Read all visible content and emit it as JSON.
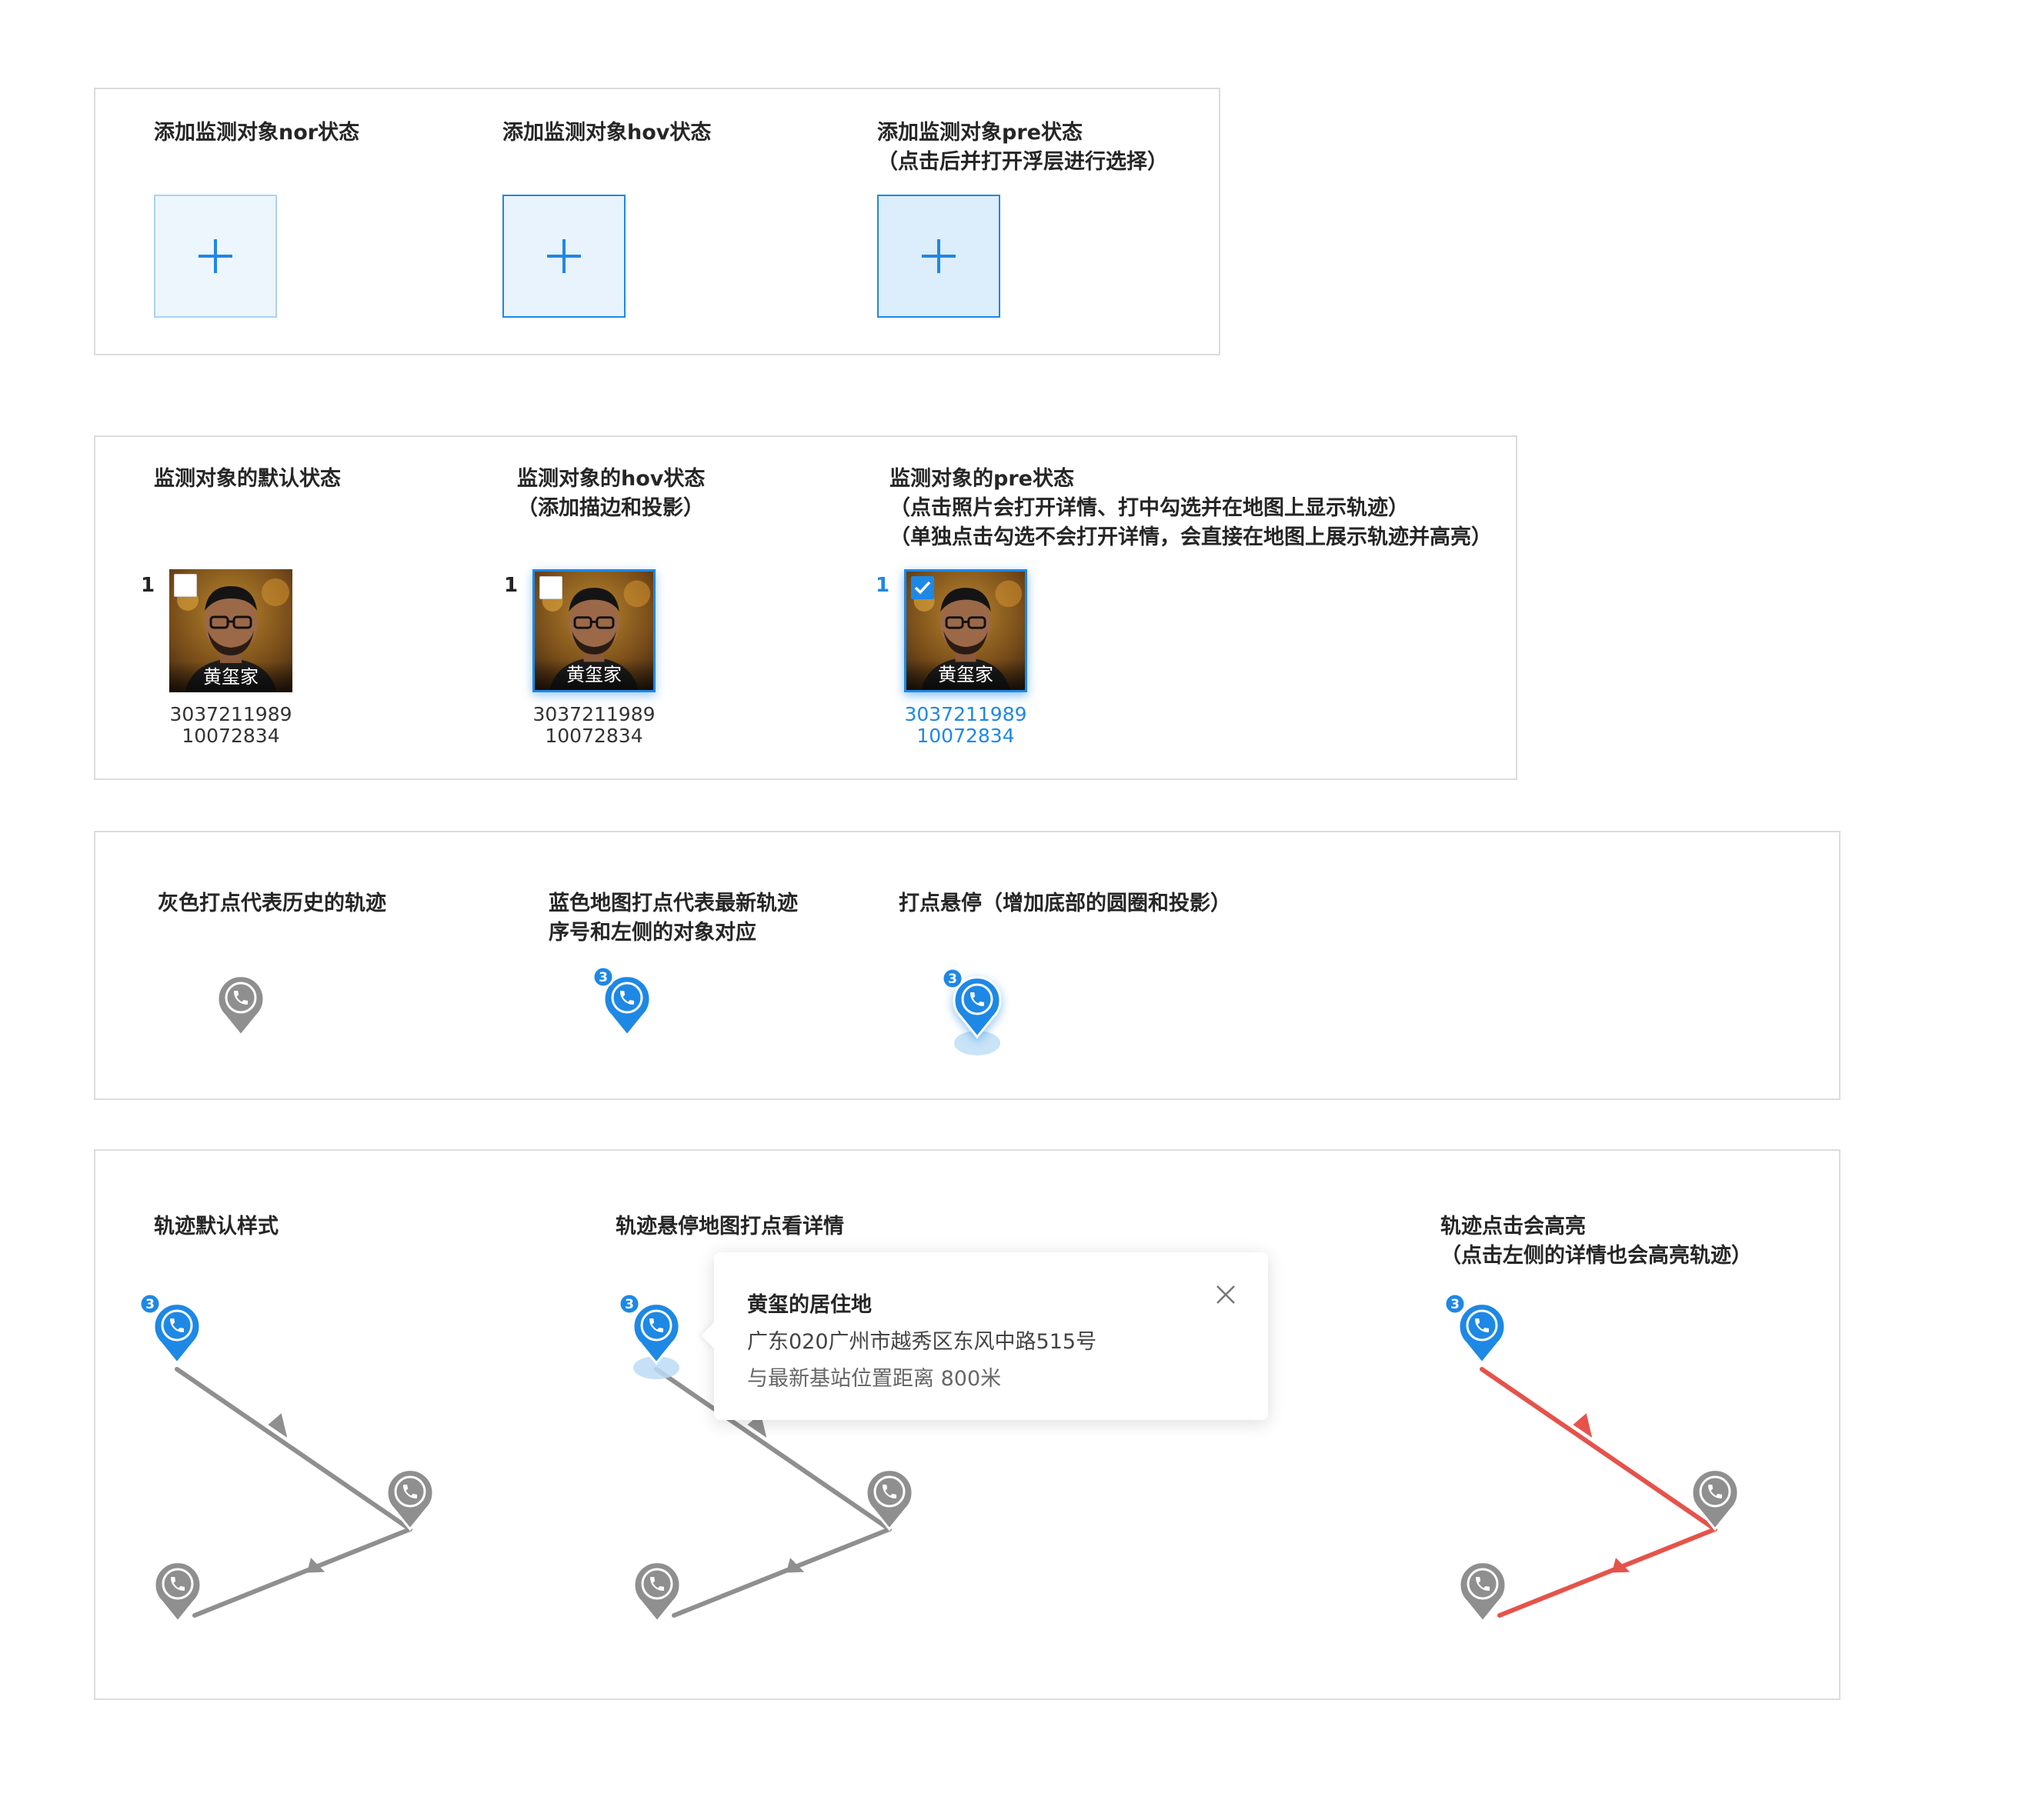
{
  "add_panel": {
    "nor_label": "添加监测对象nor状态",
    "hov_label": "添加监测对象hov状态",
    "pre_label_line1": "添加监测对象pre状态",
    "pre_label_line2": "（点击后并打开浮层进行选择）"
  },
  "object_panel": {
    "default_label": "监测对象的默认状态",
    "hov_label_line1": "监测对象的hov状态",
    "hov_label_line2": "（添加描边和投影）",
    "pre_label_line1": "监测对象的pre状态",
    "pre_label_line2": "（点击照片会打开详情、打中勾选并在地图上显示轨迹）",
    "pre_label_line3": "（单独点击勾选不会打开详情，会直接在地图上展示轨迹并高亮）",
    "person": {
      "index": "1",
      "name": "黄玺家",
      "id_line1": "3037211989",
      "id_line2": "10072834"
    }
  },
  "marker_panel": {
    "gray_label": "灰色打点代表历史的轨迹",
    "blue_label_line1": "蓝色地图打点代表最新轨迹",
    "blue_label_line2": "序号和左侧的对象对应",
    "hover_label": "打点悬停（增加底部的圆圈和投影）",
    "badge_number": "3",
    "icon": "phone-icon"
  },
  "track_panel": {
    "default_label": "轨迹默认样式",
    "hover_label": "轨迹悬停地图打点看详情",
    "click_label_line1": "轨迹点击会高亮",
    "click_label_line2": "（点击左侧的详情也会高亮轨迹）",
    "badge_number": "3",
    "tooltip": {
      "title": "黄玺的居住地",
      "address": "广东020广州市越秀区东风中路515号",
      "distance": "与最新基站位置距离 800米"
    }
  },
  "colors": {
    "blue": "#1e88e5",
    "gray": "#8f8f8f",
    "red": "#e5534b",
    "light_blue_fill": "#eef6fd"
  }
}
